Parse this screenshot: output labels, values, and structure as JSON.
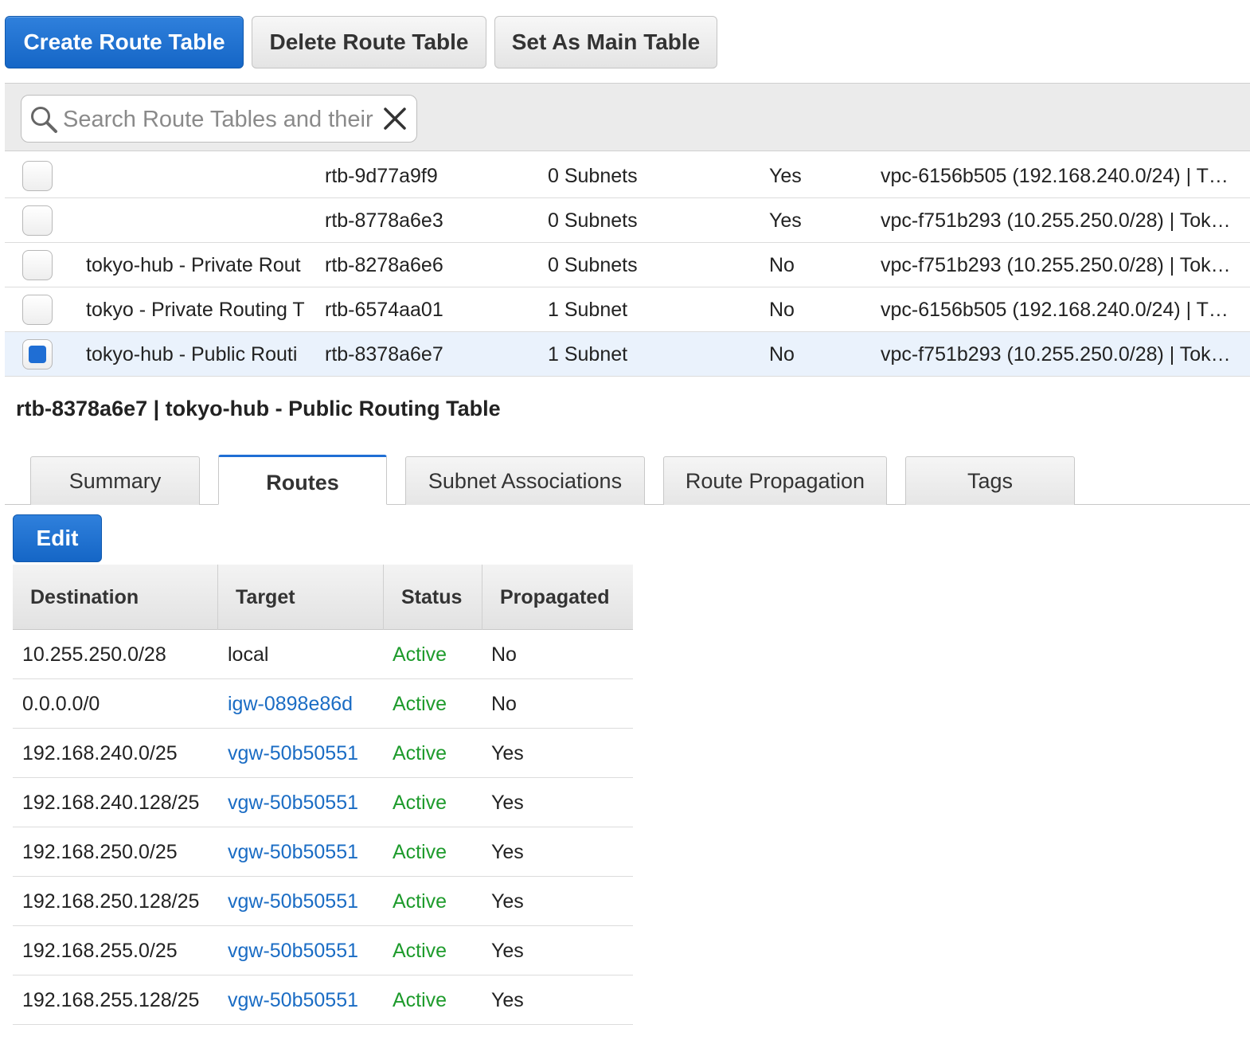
{
  "toolbar": {
    "create_label": "Create Route Table",
    "delete_label": "Delete Route Table",
    "set_main_label": "Set As Main Table"
  },
  "search": {
    "placeholder": "Search Route Tables and their"
  },
  "route_tables": [
    {
      "name": "",
      "id": "rtb-9d77a9f9",
      "associated_with": "0 Subnets",
      "main": "Yes",
      "vpc": "vpc-6156b505 (192.168.240.0/24) | T…",
      "selected": false
    },
    {
      "name": "",
      "id": "rtb-8778a6e3",
      "associated_with": "0 Subnets",
      "main": "Yes",
      "vpc": "vpc-f751b293 (10.255.250.0/28) | Tok…",
      "selected": false
    },
    {
      "name": "tokyo-hub - Private Rout",
      "id": "rtb-8278a6e6",
      "associated_with": "0 Subnets",
      "main": "No",
      "vpc": "vpc-f751b293 (10.255.250.0/28) | Tok…",
      "selected": false
    },
    {
      "name": "tokyo - Private Routing T",
      "id": "rtb-6574aa01",
      "associated_with": "1 Subnet",
      "main": "No",
      "vpc": "vpc-6156b505 (192.168.240.0/24) | T…",
      "selected": false
    },
    {
      "name": "tokyo-hub - Public Routi",
      "id": "rtb-8378a6e7",
      "associated_with": "1 Subnet",
      "main": "No",
      "vpc": "vpc-f751b293 (10.255.250.0/28) | Tok…",
      "selected": true
    }
  ],
  "details": {
    "title": "rtb-8378a6e7 | tokyo-hub - Public Routing Table",
    "tabs": {
      "summary": "Summary",
      "routes": "Routes",
      "subnet_associations": "Subnet Associations",
      "route_propagation": "Route Propagation",
      "tags": "Tags"
    },
    "active_tab": "Routes",
    "edit_label": "Edit",
    "routes_headers": {
      "destination": "Destination",
      "target": "Target",
      "status": "Status",
      "propagated": "Propagated"
    },
    "routes": [
      {
        "destination": "10.255.250.0/28",
        "target": "local",
        "target_link": false,
        "status": "Active",
        "propagated": "No"
      },
      {
        "destination": "0.0.0.0/0",
        "target": "igw-0898e86d",
        "target_link": true,
        "status": "Active",
        "propagated": "No"
      },
      {
        "destination": "192.168.240.0/25",
        "target": "vgw-50b50551",
        "target_link": true,
        "status": "Active",
        "propagated": "Yes"
      },
      {
        "destination": "192.168.240.128/25",
        "target": "vgw-50b50551",
        "target_link": true,
        "status": "Active",
        "propagated": "Yes"
      },
      {
        "destination": "192.168.250.0/25",
        "target": "vgw-50b50551",
        "target_link": true,
        "status": "Active",
        "propagated": "Yes"
      },
      {
        "destination": "192.168.250.128/25",
        "target": "vgw-50b50551",
        "target_link": true,
        "status": "Active",
        "propagated": "Yes"
      },
      {
        "destination": "192.168.255.0/25",
        "target": "vgw-50b50551",
        "target_link": true,
        "status": "Active",
        "propagated": "Yes"
      },
      {
        "destination": "192.168.255.128/25",
        "target": "vgw-50b50551",
        "target_link": true,
        "status": "Active",
        "propagated": "Yes"
      }
    ]
  },
  "colors": {
    "primary_button": "#1f6ed4",
    "link": "#1a6cc4",
    "status_active": "#1e9b2c",
    "selected_row": "#eaf2fc"
  },
  "icons": {
    "search": "search-icon",
    "clear": "close-icon",
    "checkbox": "checkbox"
  }
}
